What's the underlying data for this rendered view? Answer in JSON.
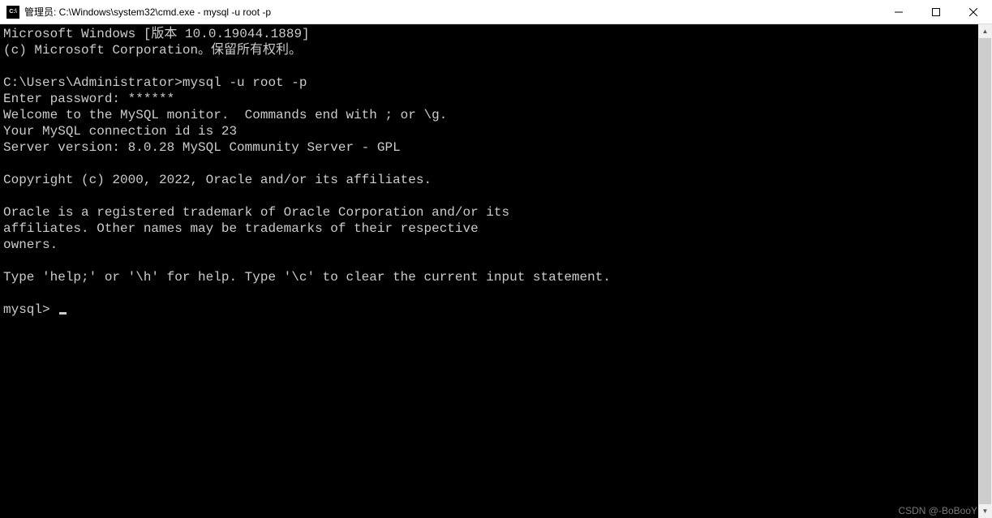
{
  "titlebar": {
    "icon_label": "C:\\",
    "text": "管理员: C:\\Windows\\system32\\cmd.exe - mysql  -u root -p"
  },
  "terminal": {
    "line1": "Microsoft Windows [版本 10.0.19044.1889]",
    "line2": "(c) Microsoft Corporation。保留所有权利。",
    "line3": "",
    "line4": "C:\\Users\\Administrator>mysql -u root -p",
    "line5": "Enter password: ******",
    "line6": "Welcome to the MySQL monitor.  Commands end with ; or \\g.",
    "line7": "Your MySQL connection id is 23",
    "line8": "Server version: 8.0.28 MySQL Community Server - GPL",
    "line9": "",
    "line10": "Copyright (c) 2000, 2022, Oracle and/or its affiliates.",
    "line11": "",
    "line12": "Oracle is a registered trademark of Oracle Corporation and/or its",
    "line13": "affiliates. Other names may be trademarks of their respective",
    "line14": "owners.",
    "line15": "",
    "line16": "Type 'help;' or '\\h' for help. Type '\\c' to clear the current input statement.",
    "line17": "",
    "prompt": "mysql> "
  },
  "watermark": "CSDN @-BoBooY"
}
